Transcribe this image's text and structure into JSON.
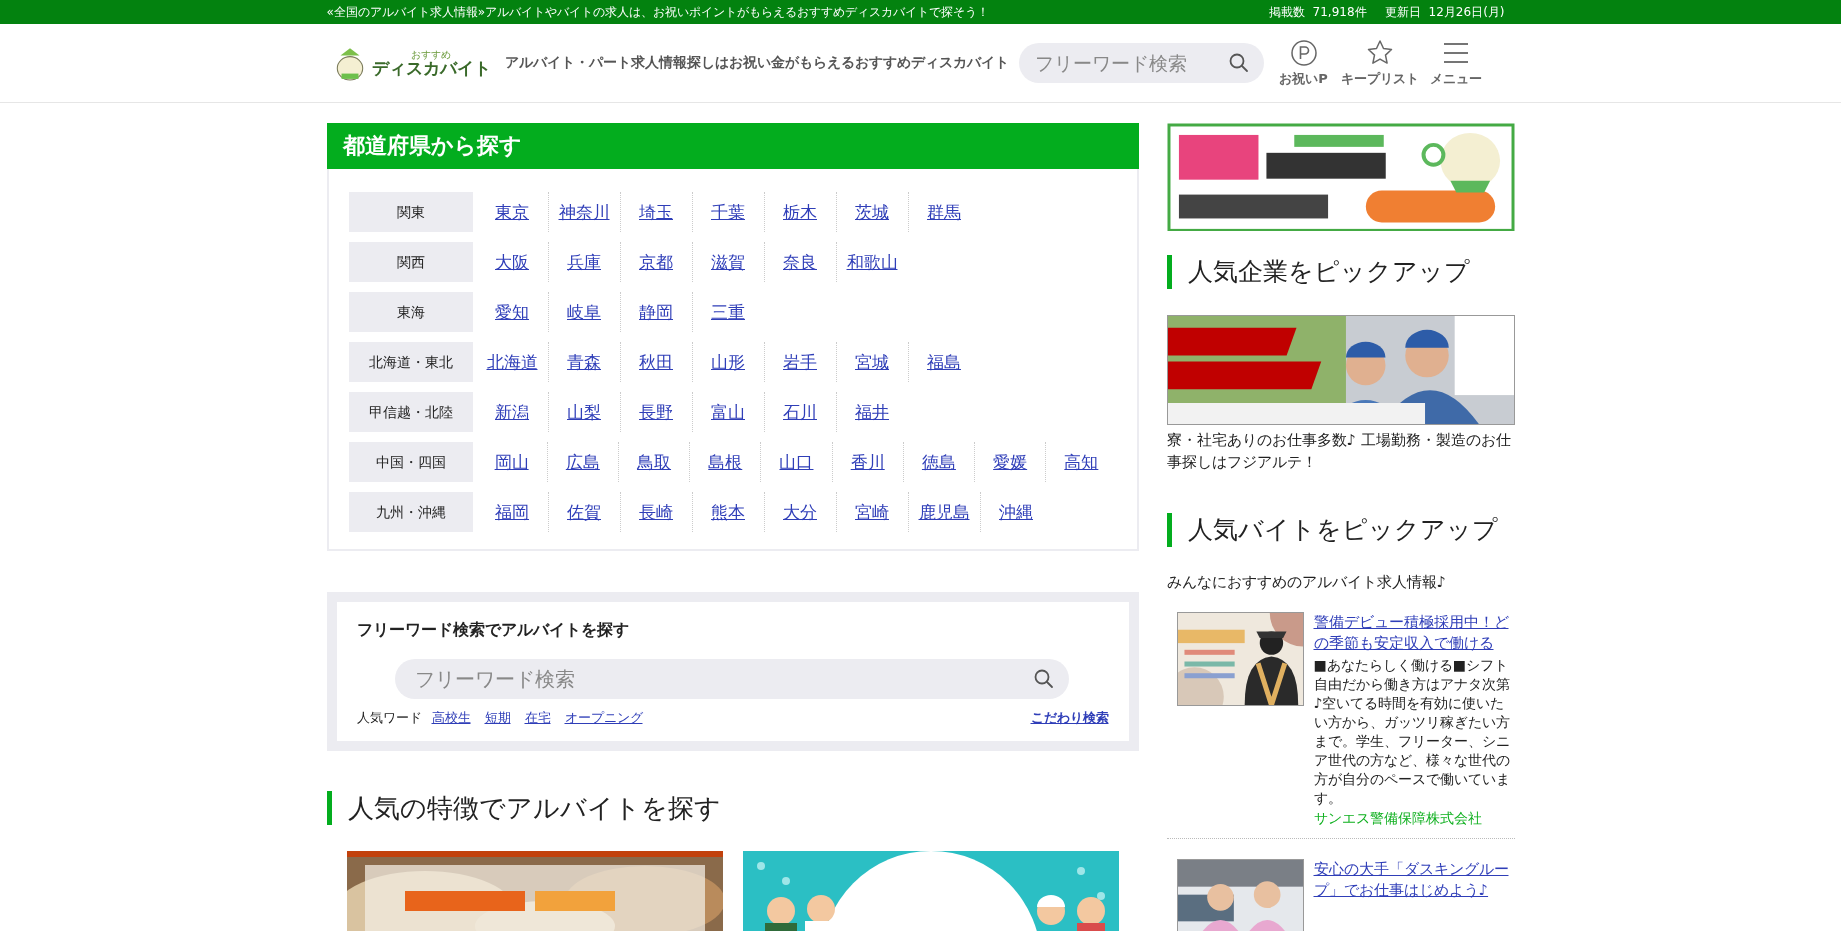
{
  "top_bar": {
    "message": "«全国のアルバイト求人情報»アルバイトやバイトの求人は、お祝いポイントがもらえるおすすめディスカバイトで探そう！",
    "count_label": "掲載数",
    "count": "71,918件",
    "updated_label": "更新日",
    "updated": "12月26日(月)"
  },
  "header": {
    "logo_small": "おすすめ",
    "logo": "ディスカバイト",
    "tagline": "アルバイト・パート求人情報探しはお祝い金がもらえるおすすめディスカバイト",
    "search": {
      "placeholder": "フリーワード検索"
    },
    "icons": [
      {
        "kind": "points",
        "label": "お祝いP"
      },
      {
        "kind": "star",
        "label": "キープリスト"
      },
      {
        "kind": "menu",
        "label": "メニュー"
      }
    ]
  },
  "regions": {
    "title": "都道府県から探す",
    "rows": [
      {
        "name": "関東",
        "prefectures": [
          "東京",
          "神奈川",
          "埼玉",
          "千葉",
          "栃木",
          "茨城",
          "群馬"
        ]
      },
      {
        "name": "関西",
        "prefectures": [
          "大阪",
          "兵庫",
          "京都",
          "滋賀",
          "奈良",
          "和歌山"
        ]
      },
      {
        "name": "東海",
        "prefectures": [
          "愛知",
          "岐阜",
          "静岡",
          "三重"
        ]
      },
      {
        "name": "北海道・東北",
        "prefectures": [
          "北海道",
          "青森",
          "秋田",
          "山形",
          "岩手",
          "宮城",
          "福島"
        ]
      },
      {
        "name": "甲信越・北陸",
        "prefectures": [
          "新潟",
          "山梨",
          "長野",
          "富山",
          "石川",
          "福井"
        ]
      },
      {
        "name": "中国・四国",
        "prefectures": [
          "岡山",
          "広島",
          "鳥取",
          "島根",
          "山口",
          "香川",
          "徳島",
          "愛媛",
          "高知"
        ]
      },
      {
        "name": "九州・沖縄",
        "prefectures": [
          "福岡",
          "佐賀",
          "長崎",
          "熊本",
          "大分",
          "宮崎",
          "鹿児島",
          "沖縄"
        ]
      }
    ]
  },
  "free_search": {
    "title": "フリーワード検索でアルバイトを探す",
    "placeholder": "フリーワード検索",
    "popular_label": "人気ワード",
    "popular_words": [
      "高校生",
      "短期",
      "在宅",
      "オープニング"
    ],
    "advanced_link": "こだわり検索"
  },
  "features": {
    "title": "人気の特徴でアルバイトを探す",
    "banners": [
      {
        "kind": "food"
      },
      {
        "kind": "dots"
      }
    ]
  },
  "sidebar": {
    "ad": {
      "kind": "ad"
    },
    "company_pickup": {
      "title": "人気企業をピックアップ",
      "banner": {
        "kind": "workers"
      },
      "description": "寮・社宅ありのお仕事多数♪ 工場勤務・製造のお仕事探しはフジアルテ！"
    },
    "job_pickup": {
      "title": "人気バイトをピックアップ",
      "intro": "みんなにおすすめのアルバイト求人情報♪",
      "jobs": [
        {
          "kind": "guard",
          "title": "警備デビュー積極採用中！どの季節も安定収入で働ける",
          "description": "■あなたらしく働ける■シフト自由だから働き方はアナタ次第♪空いてる時間を有効に使いたい方から、ガッツリ稼ぎたい方まで。学生、フリーター、シニア世代の方など、様々な世代の方が自分のペースで働いています。",
          "company": "サンエス警備保障株式会社"
        },
        {
          "kind": "van",
          "title": "安心の大手「ダスキングループ」でお仕事はじめよう♪"
        }
      ]
    }
  }
}
